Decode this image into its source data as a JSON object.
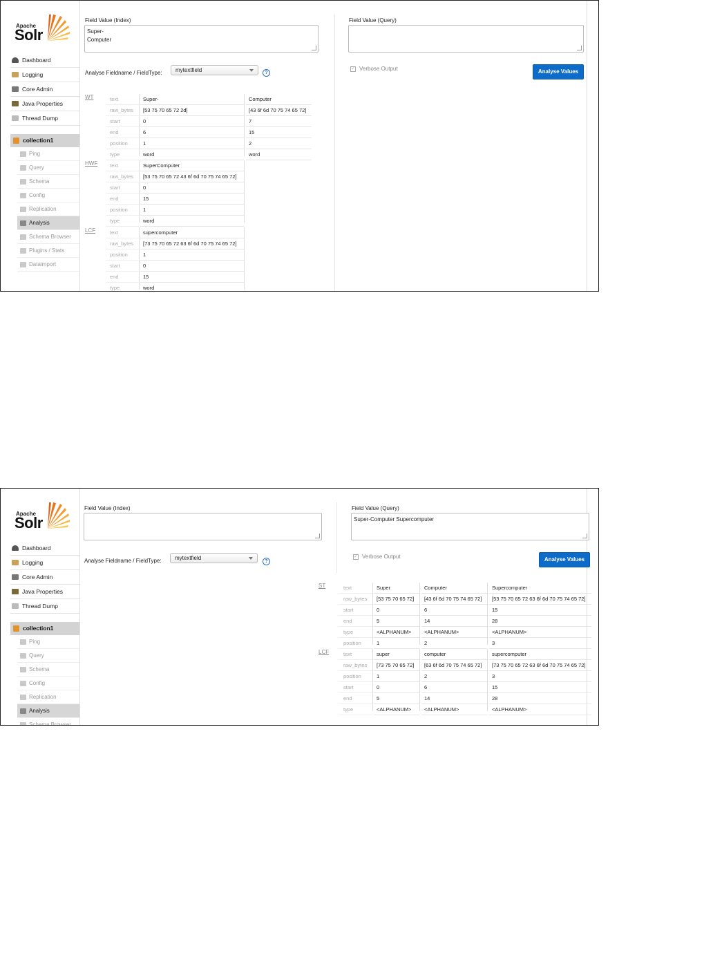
{
  "logo": {
    "apache": "Apache",
    "solr": "Solr"
  },
  "nav": [
    {
      "label": "Dashboard",
      "icon": "dashboard-icon"
    },
    {
      "label": "Logging",
      "icon": "logging-icon"
    },
    {
      "label": "Core Admin",
      "icon": "core-admin-icon"
    },
    {
      "label": "Java Properties",
      "icon": "java-properties-icon"
    },
    {
      "label": "Thread Dump",
      "icon": "thread-dump-icon"
    }
  ],
  "core": "collection1",
  "core_menu": [
    "Ping",
    "Query",
    "Schema",
    "Config",
    "Replication",
    "Analysis",
    "Schema Browser",
    "Plugins / Stats",
    "Dataimport"
  ],
  "form": {
    "index_label": "Field Value (Index)",
    "query_label": "Field Value (Query)",
    "fieldtype_label": "Analyse Fieldname / FieldType:",
    "fieldtype_value": "mytextfield",
    "verbose_label": "Verbose Output",
    "analyse_button": "Analyse Values",
    "help": "?"
  },
  "shot1": {
    "index_value": "Super-\nComputer",
    "query_value": "",
    "stages": [
      {
        "abbr": "WT",
        "keys": [
          "text",
          "raw_bytes",
          "start",
          "end",
          "position",
          "type"
        ],
        "tokens": [
          [
            "Super-",
            "[53 75 70 65 72 2d]",
            "0",
            "6",
            "1",
            "word"
          ],
          [
            "Computer",
            "[43 6f 6d 70 75 74 65 72]",
            "7",
            "15",
            "2",
            "word"
          ]
        ]
      },
      {
        "abbr": "HWF",
        "keys": [
          "text",
          "raw_bytes",
          "start",
          "end",
          "position",
          "type"
        ],
        "tokens": [
          [
            "SuperComputer",
            "[53 75 70 65 72 43 6f 6d 70 75 74 65 72]",
            "0",
            "15",
            "1",
            "word"
          ]
        ]
      },
      {
        "abbr": "LCF",
        "keys": [
          "text",
          "raw_bytes",
          "position",
          "start",
          "end",
          "type"
        ],
        "tokens": [
          [
            "supercomputer",
            "[73 75 70 65 72 63 6f 6d 70 75 74 65 72]",
            "1",
            "0",
            "15",
            "word"
          ]
        ]
      }
    ]
  },
  "shot2": {
    "index_value": "",
    "query_value": "Super-Computer Supercomputer",
    "stages": [
      {
        "abbr": "ST",
        "keys": [
          "text",
          "raw_bytes",
          "start",
          "end",
          "type",
          "position"
        ],
        "tokens": [
          [
            "Super",
            "[53 75 70 65 72]",
            "0",
            "5",
            "<ALPHANUM>",
            "1"
          ],
          [
            "Computer",
            "[43 6f 6d 70 75 74 65 72]",
            "6",
            "14",
            "<ALPHANUM>",
            "2"
          ],
          [
            "Supercomputer",
            "[53 75 70 65 72 63 6f 6d 70 75 74 65 72]",
            "15",
            "28",
            "<ALPHANUM>",
            "3"
          ]
        ]
      },
      {
        "abbr": "LCF",
        "keys": [
          "text",
          "raw_bytes",
          "position",
          "start",
          "end",
          "type"
        ],
        "tokens": [
          [
            "super",
            "[73 75 70 65 72]",
            "1",
            "0",
            "5",
            "<ALPHANUM>"
          ],
          [
            "computer",
            "[63 6f 6d 70 75 74 65 72]",
            "2",
            "6",
            "14",
            "<ALPHANUM>"
          ],
          [
            "supercomputer",
            "[73 75 70 65 72 63 6f 6d 70 75 74 65 72]",
            "3",
            "15",
            "28",
            "<ALPHANUM>"
          ]
        ]
      }
    ]
  },
  "colors": {
    "accent": "#0d6cc9",
    "logo_sun": "#e8751a",
    "core_icon": "#e0922f",
    "active_bg": "#d6d6d6"
  }
}
